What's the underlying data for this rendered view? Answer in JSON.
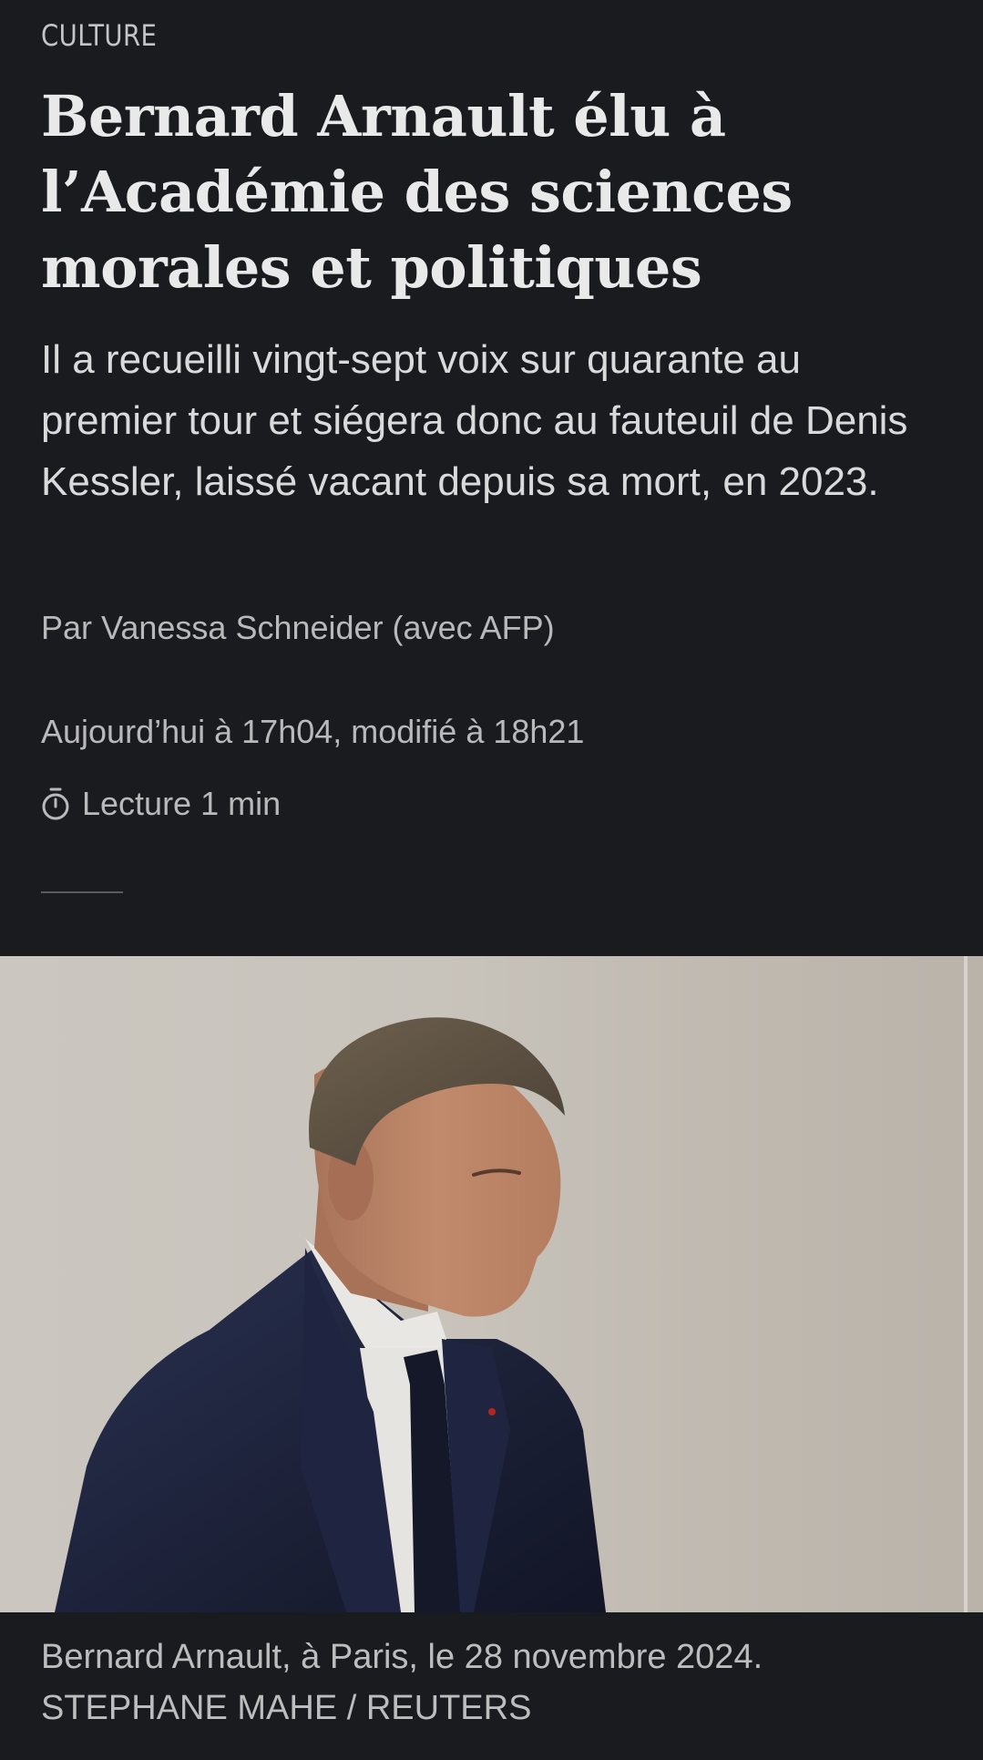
{
  "article": {
    "rubric": "CULTURE",
    "headline": "Bernard Arnault élu à l’Académie des sciences morales et politiques",
    "standfirst": "Il a recueilli vingt-sept voix sur quarante au premier tour et siégera donc au fauteuil de Denis Kessler, laissé vacant depuis sa mort, en 2023.",
    "byline": "Par Vanessa Schneider (avec AFP)",
    "dateline": "Aujourd’hui à 17h04, modifié à 18h21",
    "reading_time": "Lecture 1 min",
    "reading_time_icon": "stopwatch-icon"
  },
  "photo": {
    "caption": "Bernard Arnault, à Paris, le 28 novembre 2024.",
    "credit": "STEPHANE MAHE / REUTERS"
  },
  "colors": {
    "background": "#1a1b1f",
    "headline": "#e9e9e9",
    "meta_text": "#b9b9b9"
  }
}
